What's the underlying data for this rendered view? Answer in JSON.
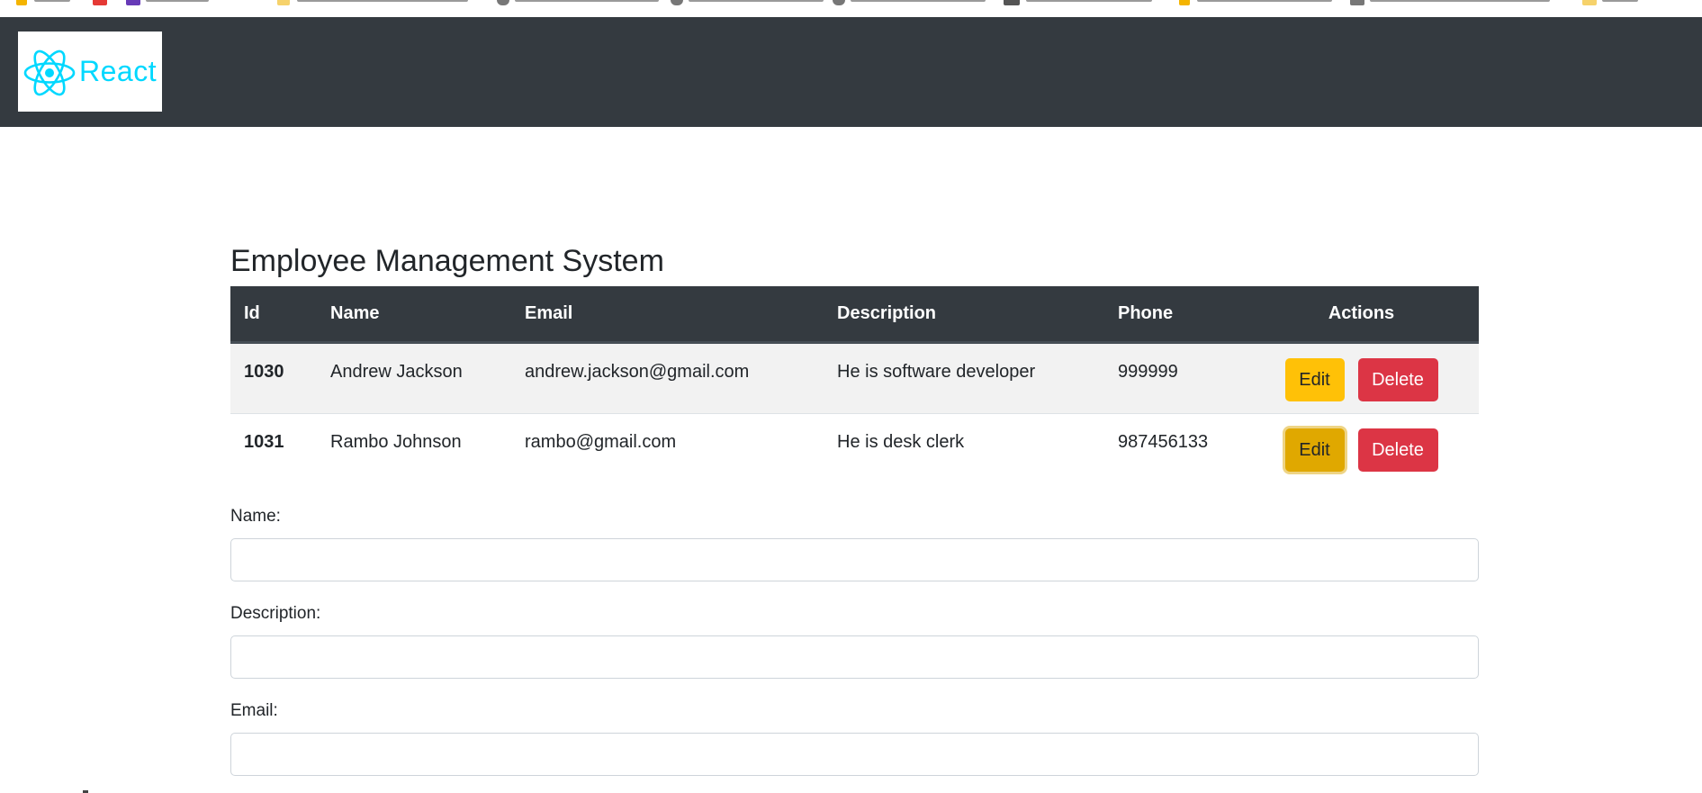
{
  "brand": {
    "logo_text": "React",
    "logo_color": "#00d8ff"
  },
  "page": {
    "title": "Employee Management System"
  },
  "table": {
    "headers": [
      "Id",
      "Name",
      "Email",
      "Description",
      "Phone",
      "Actions"
    ],
    "rows": [
      {
        "id": "1030",
        "name": "Andrew Jackson",
        "email": "andrew.jackson@gmail.com",
        "description": "He is software developer",
        "phone": "999999"
      },
      {
        "id": "1031",
        "name": "Rambo Johnson",
        "email": "rambo@gmail.com",
        "description": "He is desk clerk",
        "phone": "987456133"
      }
    ],
    "edit_label": "Edit",
    "delete_label": "Delete"
  },
  "form": {
    "name_label": "Name:",
    "name_value": "",
    "description_label": "Description:",
    "description_value": "",
    "email_label": "Email:",
    "email_value": ""
  },
  "colors": {
    "navbar": "#343a40",
    "edit": "#ffc107",
    "edit_active": "#e0a800",
    "delete": "#dc3545"
  }
}
